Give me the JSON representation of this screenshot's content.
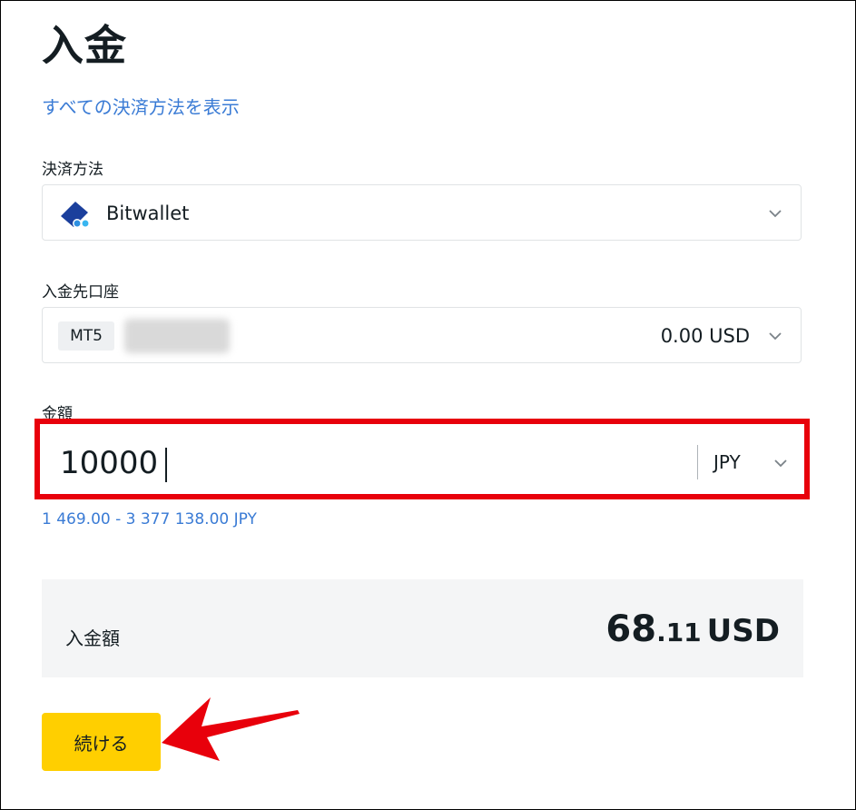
{
  "page": {
    "title": "入金"
  },
  "links": {
    "show_all_methods": "すべての決済方法を表示"
  },
  "payment_method": {
    "label": "決済方法",
    "selected": "Bitwallet",
    "icon": "bitwallet-logo"
  },
  "account": {
    "label": "入金先口座",
    "platform_badge": "MT5",
    "balance": "0.00 USD"
  },
  "amount": {
    "label": "金額",
    "value": "10000",
    "currency": "JPY",
    "range_hint": "1 469.00 - 3 377 138.00 JPY"
  },
  "summary": {
    "label": "入金額",
    "amount_integer": "68",
    "amount_decimal": ".11",
    "currency": "USD"
  },
  "actions": {
    "continue_label": "続ける"
  },
  "colors": {
    "link": "#3a7bd5",
    "highlight_border": "#e8000b",
    "arrow": "#e8000b",
    "primary_button": "#ffcf00",
    "summary_bg": "#f4f5f6"
  }
}
